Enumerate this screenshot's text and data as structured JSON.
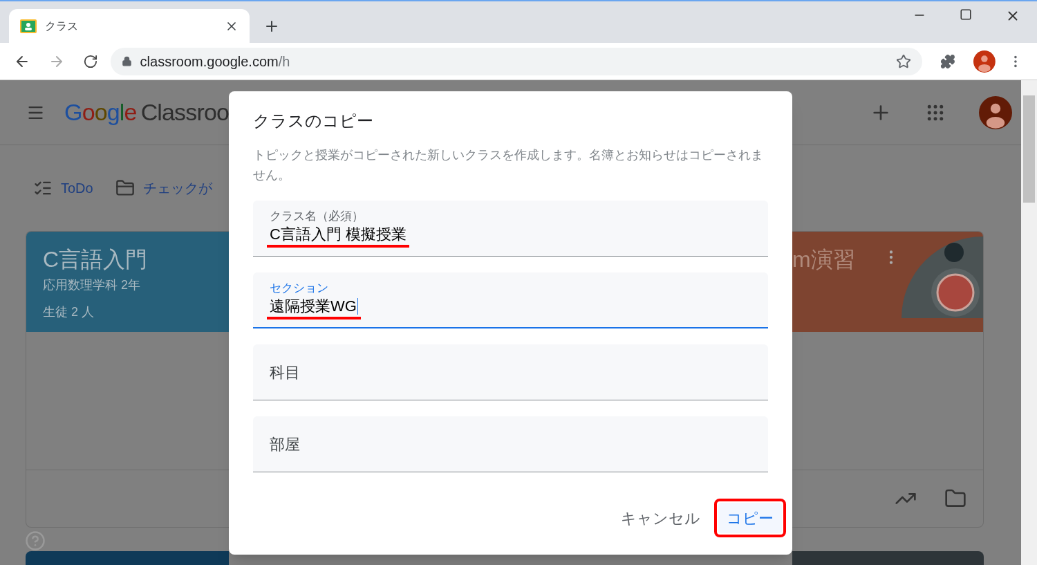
{
  "browser": {
    "tab": {
      "title": "クラス"
    },
    "address": {
      "host": "classroom.google.com",
      "path": "/h"
    }
  },
  "app": {
    "logo_word": "Google",
    "logo_product": "Classroo"
  },
  "nav": [
    {
      "label": "ToDo",
      "kind": "todo"
    },
    {
      "label": "チェックが",
      "kind": "review"
    }
  ],
  "cards": [
    {
      "title": "C言語入門",
      "section": "応用数理学科 2年",
      "students": "生徒 2 人",
      "color": "#27607a"
    },
    {
      "title": "m演習",
      "color": "#7e4430"
    }
  ],
  "dialog": {
    "title": "クラスのコピー",
    "description": "トピックと授業がコピーされた新しいクラスを作成します。名簿とお知らせはコピーされません。",
    "fields": [
      {
        "label": "クラス名（必須）",
        "value": "C言語入門 模擬授業",
        "focused": false,
        "annotated": true
      },
      {
        "label": "セクション",
        "value": "遠隔授業WG",
        "focused": true,
        "annotated": true
      },
      {
        "label": "科目",
        "focused": false,
        "annotated": false
      },
      {
        "label": "部屋",
        "focused": false,
        "annotated": false
      }
    ],
    "buttons": [
      {
        "label": "キャンセル",
        "kind": "text",
        "highlighted": false
      },
      {
        "label": "コピー",
        "kind": "primary",
        "highlighted": true
      }
    ]
  }
}
